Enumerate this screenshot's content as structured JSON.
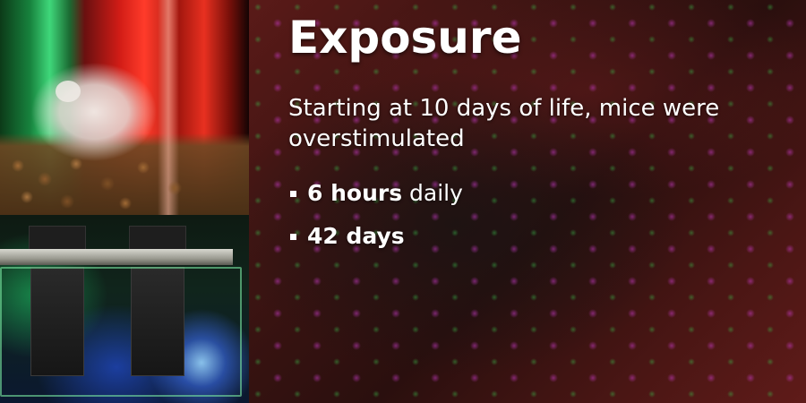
{
  "slide": {
    "title": "Exposure",
    "lead": "Starting at 10 days of life, mice were overstimulated",
    "bullets": [
      {
        "bold": "6 hours",
        "rest": " daily"
      },
      {
        "bold": "42 days",
        "rest": ""
      }
    ]
  },
  "images": {
    "top": {
      "semantic": "mouse-in-cage-photo"
    },
    "bottom": {
      "semantic": "speaker-rig-photo"
    }
  },
  "colors": {
    "text": "#ffffff",
    "background": "#3c1412",
    "accent_red": "#d11c16",
    "accent_green": "#3fd77a",
    "accent_blue": "#3c6ef0"
  }
}
